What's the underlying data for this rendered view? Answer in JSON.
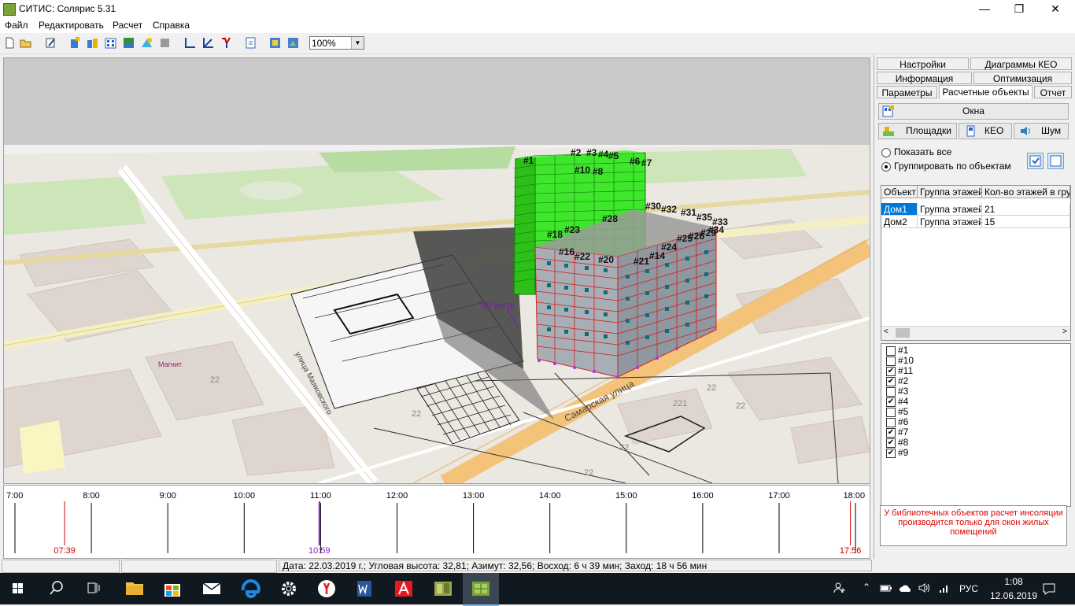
{
  "window": {
    "title": "СИТИС: Солярис 5.31",
    "minimize": "—",
    "maximize": "❐",
    "close": "✕"
  },
  "menu": [
    "Файл",
    "Редактировать",
    "Расчет",
    "Справка"
  ],
  "toolbar": {
    "zoom_value": "100%",
    "icons": [
      "new-icon",
      "open-icon",
      "edit-icon",
      "building-add-icon",
      "buildings-icon",
      "windows-icon",
      "map-icon",
      "sun-icon",
      "stop-icon",
      "axis-icon",
      "axis-3d-icon",
      "report-icon",
      "export-icon",
      "view-icon",
      "view2-icon"
    ]
  },
  "viewport": {
    "distance_label": "50 метр",
    "street_labels": [
      "улица Маяковского",
      "Самарская улица"
    ],
    "poi_label": "Магнит",
    "house_numbers": [
      "22",
      "22",
      "22",
      "22",
      "22",
      "221",
      "22"
    ],
    "window_labels": [
      "#1",
      "#2",
      "#3",
      "#4",
      "#5",
      "#6",
      "#7",
      "#8",
      "#9",
      "#10",
      "#11",
      "#12",
      "#13",
      "#14",
      "#15",
      "#16",
      "#17",
      "#18",
      "#19",
      "#20",
      "#21",
      "#22",
      "#23",
      "#24",
      "#25",
      "#26",
      "#27",
      "#28",
      "#29",
      "#30",
      "#31",
      "#32",
      "#33",
      "#34",
      "#35"
    ],
    "colors": {
      "sky": "#c8c8c8",
      "ground": "#ece8e2",
      "green": "#c8e6b4",
      "road_yellow": "#f3c37a",
      "building_green": "#3ee62c",
      "building_red": "#d42020"
    }
  },
  "timeline": {
    "hours": [
      "7:00",
      "8:00",
      "9:00",
      "10:00",
      "11:00",
      "12:00",
      "13:00",
      "14:00",
      "15:00",
      "16:00",
      "17:00",
      "18:00"
    ],
    "markers": [
      {
        "label": "07:39",
        "color": "#cc0000"
      },
      {
        "label": "10:59",
        "color": "#8a1cc0"
      },
      {
        "label": "17:56",
        "color": "#cc0000"
      }
    ]
  },
  "status": {
    "text": "Дата: 22.03.2019 г.; Угловая высота: 32,81; Азимут: 32,56; Восход: 6 ч 39 мин; Заход: 18 ч 56 мин"
  },
  "panel": {
    "tabs_row1": [
      "Настройки",
      "Диаграммы КЕО"
    ],
    "tabs_row2": [
      "Информация",
      "Оптимизация"
    ],
    "tabs_row3": [
      "Параметры",
      "Расчетные объекты",
      "Отчет"
    ],
    "windows_button": "Окна",
    "sub_buttons": [
      "Площадки",
      "КЕО",
      "Шум"
    ],
    "radio_show_all": "Показать все",
    "radio_group": "Группировать по объектам",
    "table": {
      "headers": [
        "Объект",
        "Группа этажей",
        "Кол-во этажей в гру"
      ],
      "rows": [
        [
          "Дом1",
          "Группа этажей",
          "21"
        ],
        [
          "Дом2",
          "Группа этажей",
          "15"
        ]
      ]
    },
    "checklist": [
      {
        "label": "#1",
        "checked": false
      },
      {
        "label": "#10",
        "checked": false
      },
      {
        "label": "#11",
        "checked": true
      },
      {
        "label": "#2",
        "checked": true
      },
      {
        "label": "#3",
        "checked": false
      },
      {
        "label": "#4",
        "checked": true
      },
      {
        "label": "#5",
        "checked": false
      },
      {
        "label": "#6",
        "checked": false
      },
      {
        "label": "#7",
        "checked": true
      },
      {
        "label": "#8",
        "checked": true
      },
      {
        "label": "#9",
        "checked": true
      }
    ],
    "warning": "У библиотечных объектов расчет инсоляции производится только для окон жилых помещений"
  },
  "taskbar": {
    "apps": [
      "start-icon",
      "search-icon",
      "task-view-icon",
      "file-explorer-icon",
      "store-icon",
      "mail-icon",
      "edge-icon",
      "settings-icon",
      "yandex-icon",
      "word-icon",
      "autocad-icon",
      "sitis-icon",
      "solaris-icon"
    ],
    "language": "РУС",
    "time": "1:08",
    "date": "12.06.2019"
  }
}
